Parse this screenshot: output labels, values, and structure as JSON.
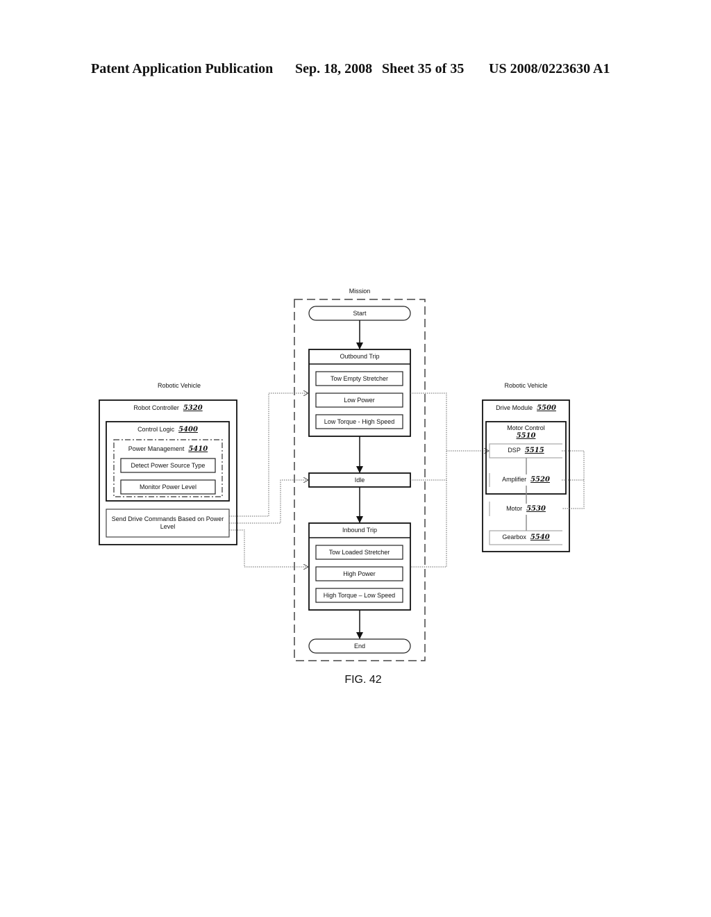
{
  "header": {
    "publication": "Patent Application Publication",
    "date": "Sep. 18, 2008",
    "sheet": "Sheet 35 of 35",
    "number": "US 2008/0223630 A1"
  },
  "mission": {
    "title": "Mission",
    "start": "Start",
    "end": "End",
    "idle": "Idle",
    "outbound": {
      "title": "Outbound Trip",
      "items": [
        "Tow  Empty Stretcher",
        "Low Power",
        "Low Torque - High Speed"
      ]
    },
    "inbound": {
      "title": "Inbound Trip",
      "items": [
        "Tow  Loaded Stretcher",
        "High Power",
        "High Torque – Low Speed"
      ]
    }
  },
  "left_vehicle": {
    "title": "Robotic Vehicle",
    "robot_controller": {
      "label": "Robot Controller",
      "ref": "5320"
    },
    "control_logic": {
      "label": "Control Logic",
      "ref": "5400"
    },
    "power_management": {
      "label": "Power Management",
      "ref": "5410"
    },
    "detect": "Detect Power Source Type",
    "monitor": "Monitor Power Level",
    "send_line1": "Send Drive Commands Based on Power",
    "send_line2": "Level"
  },
  "right_vehicle": {
    "title": "Robotic Vehicle",
    "drive_module": {
      "label": "Drive Module",
      "ref": "5500"
    },
    "motor_control": {
      "label": "Motor Control",
      "ref": "5510"
    },
    "dsp": {
      "label": "DSP",
      "ref": "5515"
    },
    "amplifier": {
      "label": "Amplifier",
      "ref": "5520"
    },
    "motor": {
      "label": "Motor",
      "ref": "5530"
    },
    "gearbox": {
      "label": "Gearbox",
      "ref": "5540"
    }
  },
  "figure_label": "FIG. 42"
}
